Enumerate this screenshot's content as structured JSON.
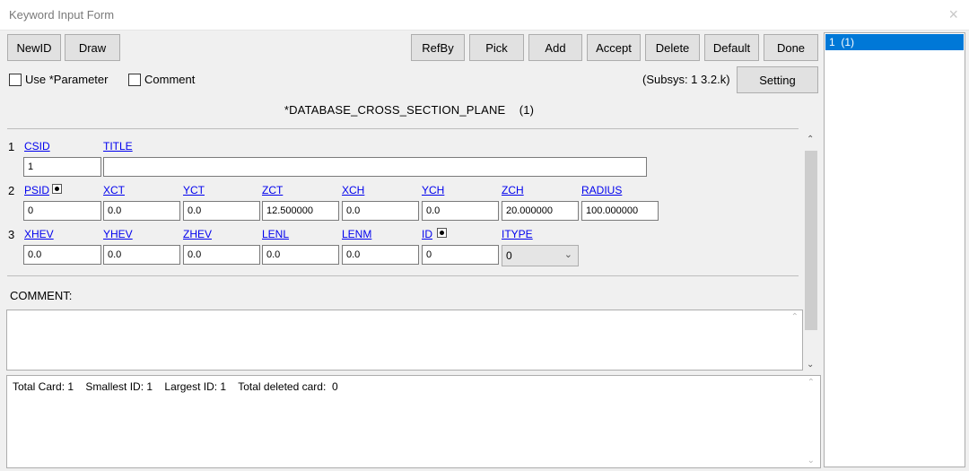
{
  "window": {
    "title": "Keyword Input Form",
    "close_glyph": "×"
  },
  "toolbar": {
    "newid": "NewID",
    "draw": "Draw",
    "refby": "RefBy",
    "pick": "Pick",
    "add": "Add",
    "accept": "Accept",
    "delete": "Delete",
    "default": "Default",
    "done": "Done"
  },
  "options": {
    "use_parameter": "Use *Parameter",
    "comment": "Comment",
    "subsys": "(Subsys: 1 3.2.k)",
    "setting": "Setting"
  },
  "keyword": {
    "title": "*DATABASE_CROSS_SECTION_PLANE",
    "count": "(1)"
  },
  "cards": [
    {
      "row": "1",
      "fields": [
        {
          "label": "CSID",
          "value": "1"
        },
        {
          "label": "TITLE",
          "value": ""
        }
      ]
    },
    {
      "row": "2",
      "fields": [
        {
          "label": "PSID",
          "value": "0"
        },
        {
          "label": "XCT",
          "value": "0.0"
        },
        {
          "label": "YCT",
          "value": "0.0"
        },
        {
          "label": "ZCT",
          "value": "12.500000"
        },
        {
          "label": "XCH",
          "value": "0.0"
        },
        {
          "label": "YCH",
          "value": "0.0"
        },
        {
          "label": "ZCH",
          "value": "20.000000"
        },
        {
          "label": "RADIUS",
          "value": "100.000000"
        }
      ]
    },
    {
      "row": "3",
      "fields": [
        {
          "label": "XHEV",
          "value": "0.0"
        },
        {
          "label": "YHEV",
          "value": "0.0"
        },
        {
          "label": "ZHEV",
          "value": "0.0"
        },
        {
          "label": "LENL",
          "value": "0.0"
        },
        {
          "label": "LENM",
          "value": "0.0"
        },
        {
          "label": "ID",
          "value": "0"
        },
        {
          "label": "ITYPE",
          "value": "0"
        }
      ]
    }
  ],
  "comment": {
    "label": "COMMENT:",
    "value": ""
  },
  "status": {
    "text": "Total Card: 1    Smallest ID: 1    Largest ID: 1    Total deleted card:  0"
  },
  "id_list": {
    "items": [
      "1  (1)"
    ]
  },
  "colors": {
    "selection": "#0078d7",
    "link": "#0000ee"
  }
}
